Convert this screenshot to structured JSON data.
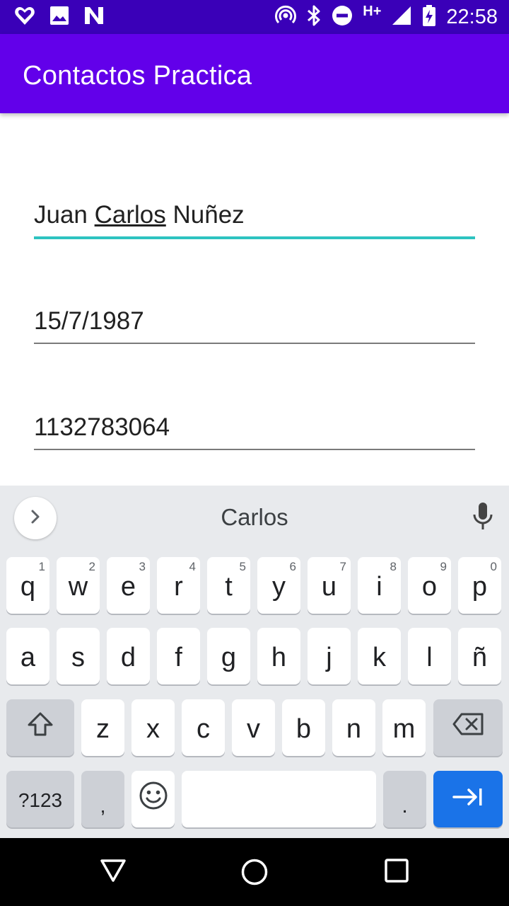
{
  "status_bar": {
    "left_icons": [
      "heart-icon",
      "image-icon",
      "n-app-icon"
    ],
    "right_icons": [
      "hotspot-icon",
      "bluetooth-icon",
      "do-not-disturb-icon",
      "signal-icon",
      "battery-charging-icon"
    ],
    "network": "H+",
    "time": "22:58"
  },
  "app_bar": {
    "title": "Contactos Practica"
  },
  "form": {
    "name_value": "Juan Carlos Nuñez",
    "name_parts": [
      "Juan ",
      "Carlos",
      " Nuñez"
    ],
    "date_value": "15/7/1987",
    "phone_value": "1132783064"
  },
  "keyboard": {
    "suggestion": "Carlos",
    "row1": [
      {
        "k": "q",
        "h": "1"
      },
      {
        "k": "w",
        "h": "2"
      },
      {
        "k": "e",
        "h": "3"
      },
      {
        "k": "r",
        "h": "4"
      },
      {
        "k": "t",
        "h": "5"
      },
      {
        "k": "y",
        "h": "6"
      },
      {
        "k": "u",
        "h": "7"
      },
      {
        "k": "i",
        "h": "8"
      },
      {
        "k": "o",
        "h": "9"
      },
      {
        "k": "p",
        "h": "0"
      }
    ],
    "row2": [
      "a",
      "s",
      "d",
      "f",
      "g",
      "h",
      "j",
      "k",
      "l",
      "ñ"
    ],
    "row3": [
      "z",
      "x",
      "c",
      "v",
      "b",
      "n",
      "m"
    ],
    "symbols_label": "?123",
    "comma_label": ",",
    "period_label": "."
  },
  "colors": {
    "status_bar": "#3a00b8",
    "app_bar": "#6200ea",
    "focus_underline": "#2dc3c0",
    "action_key": "#1a73e8"
  }
}
